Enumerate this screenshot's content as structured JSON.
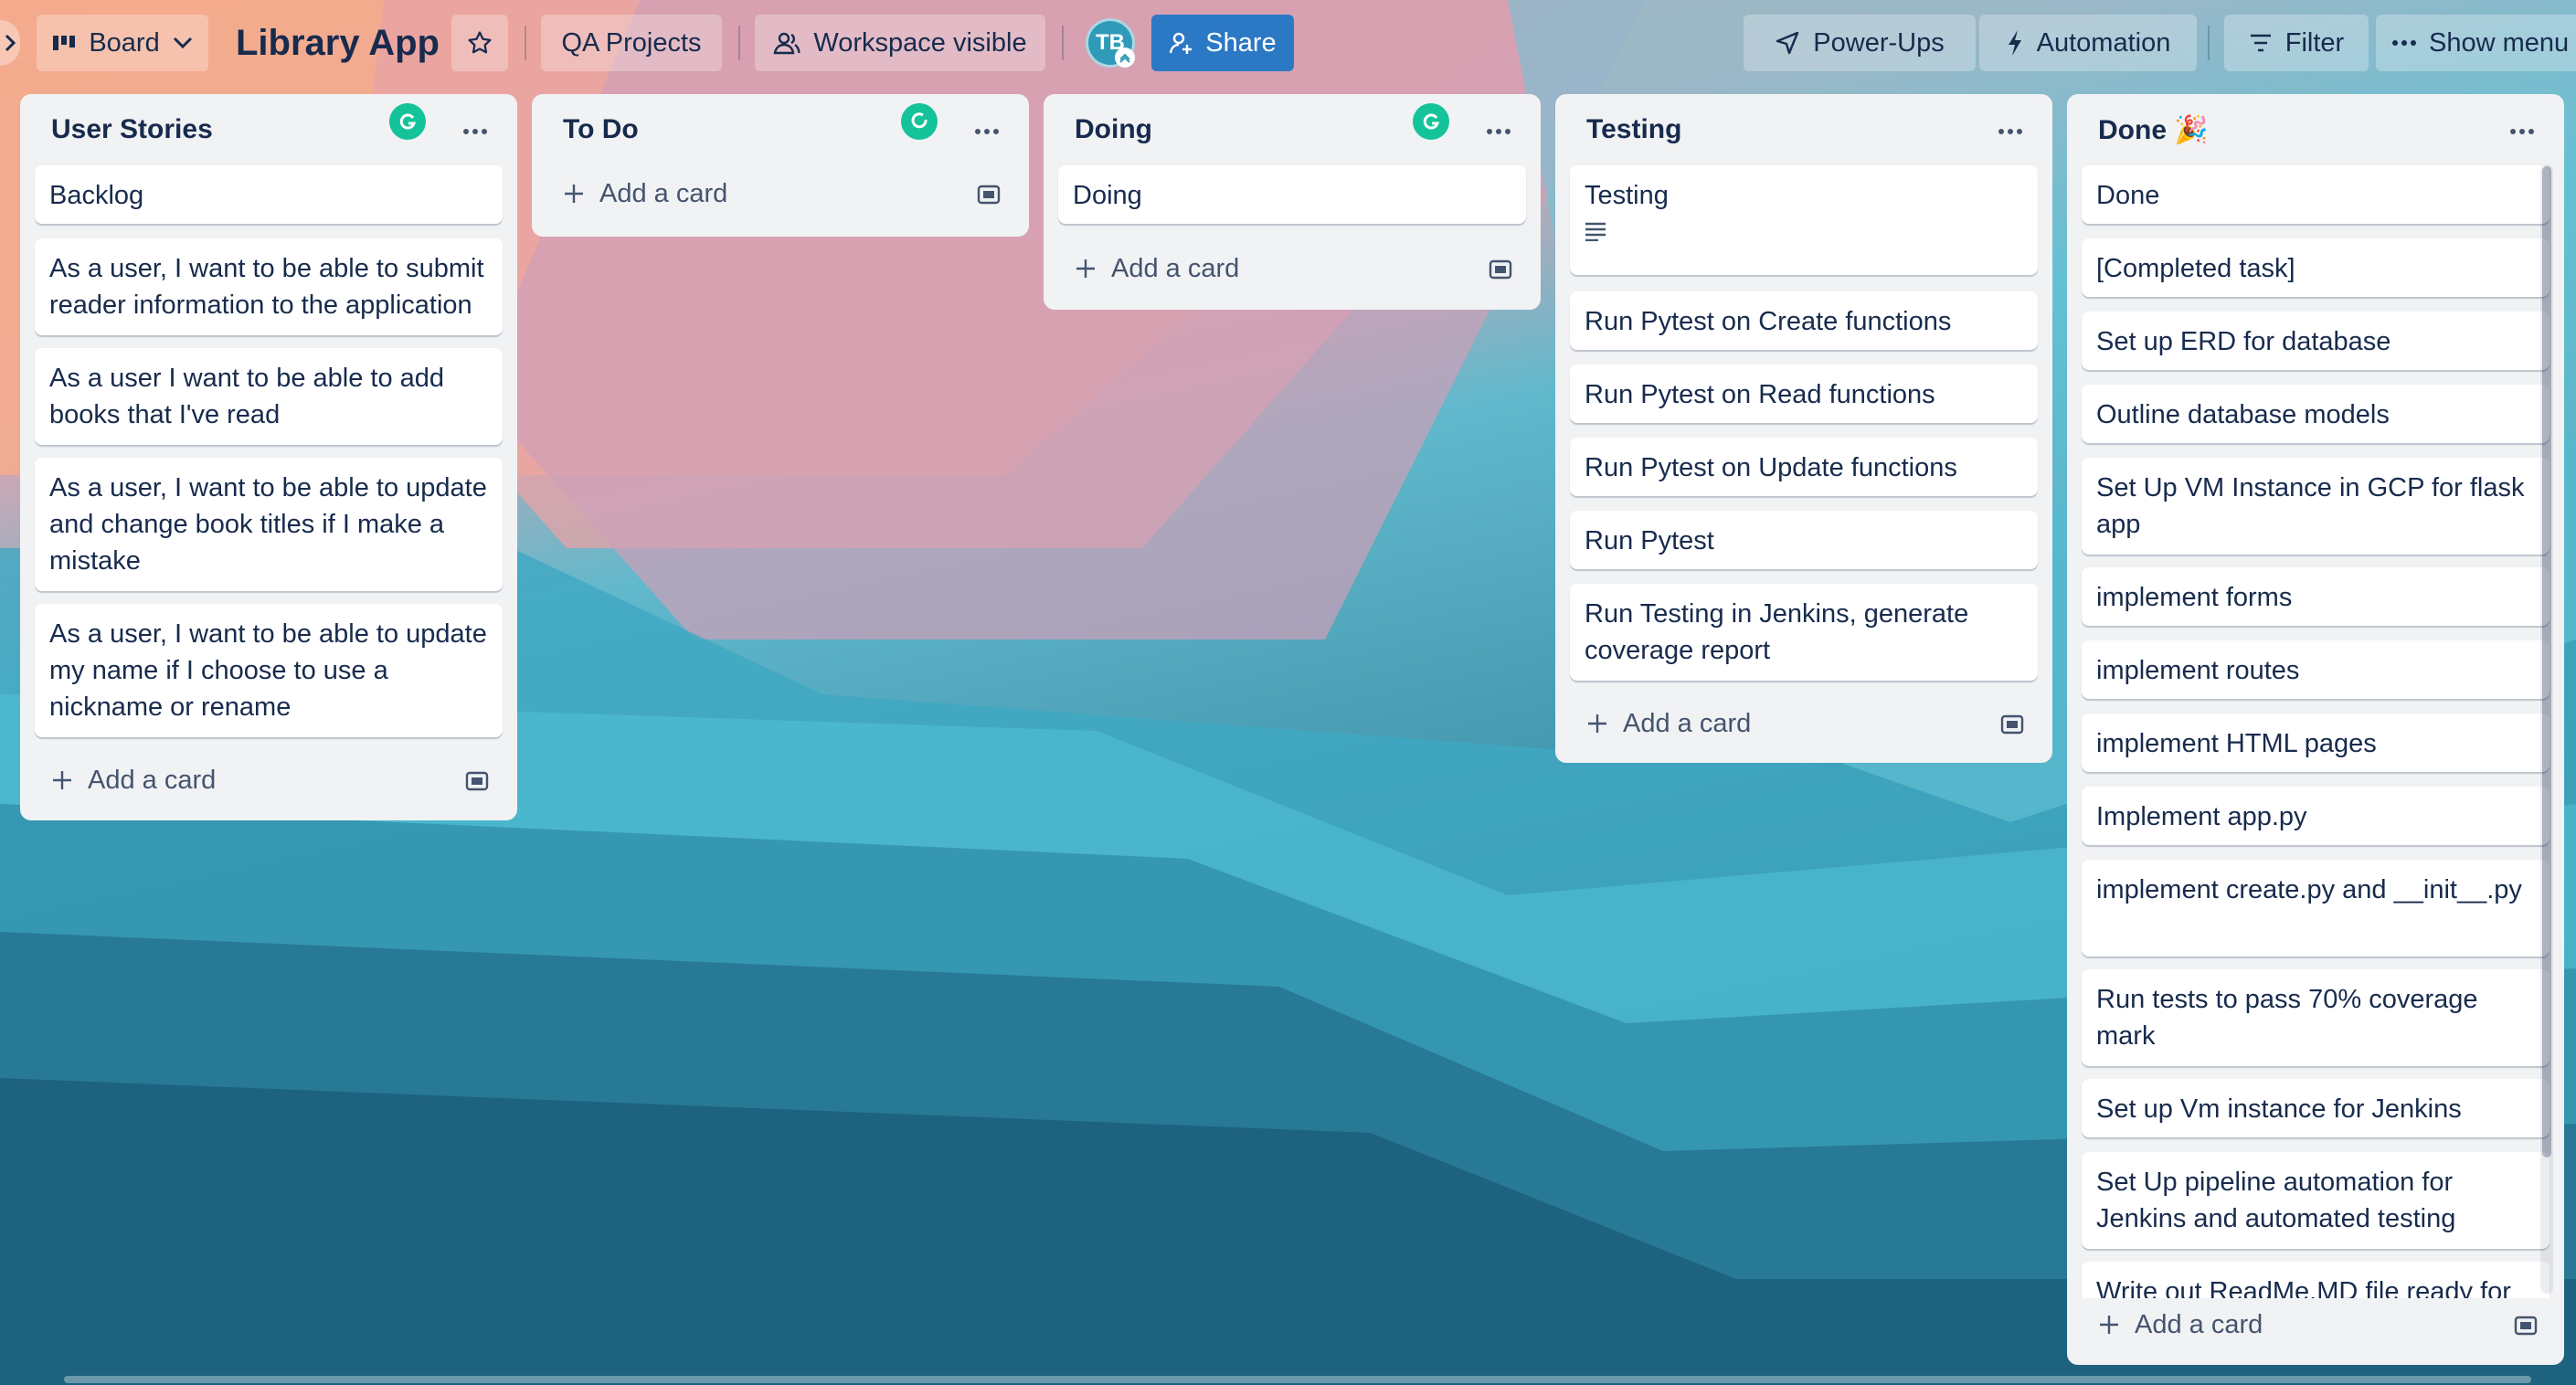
{
  "header": {
    "view_label": "Board",
    "board_title": "Library App",
    "workspace_label": "QA Projects",
    "visibility_label": "Workspace visible",
    "avatar_initials": "TB",
    "share_label": "Share",
    "powerups_label": "Power-Ups",
    "automation_label": "Automation",
    "filter_label": "Filter",
    "show_menu_label": "Show menu"
  },
  "add_card_label": "Add a card",
  "lists": [
    {
      "title": "User Stories",
      "cards": [
        "Backlog",
        "As a user, I want to be able to submit reader information to the application",
        "As a user I want to be able to add books that I've read",
        "As a user, I want to be able to update and change book titles if I make a mistake",
        "As a user, I want to be able to update my name if I choose to use a nickname or rename"
      ]
    },
    {
      "title": "To Do",
      "cards": []
    },
    {
      "title": "Doing",
      "cards": [
        "Doing"
      ]
    },
    {
      "title": "Testing",
      "cards": [
        "Testing",
        "Run Pytest on Create functions",
        "Run Pytest on Read functions",
        "Run Pytest on Update functions",
        "Run Pytest",
        "Run Testing in Jenkins, generate coverage report"
      ]
    },
    {
      "title": "Done 🎉",
      "cards": [
        "Done",
        "[Completed task]",
        "Set up ERD for database",
        "Outline database models",
        "Set Up VM Instance in GCP for flask app",
        "implement forms",
        "implement routes",
        "implement HTML pages",
        "Implement app.py",
        "implement create.py and __init__.py",
        "Run tests to pass 70% coverage mark",
        "Set up Vm instance for Jenkins",
        "Set Up pipeline automation for Jenkins and automated testing",
        "Write out ReadMe.MD file ready for"
      ]
    }
  ],
  "colors": {
    "share": "#2b78c5",
    "list_bg": "#f1f2f4",
    "grammarly": "#15c39a"
  }
}
